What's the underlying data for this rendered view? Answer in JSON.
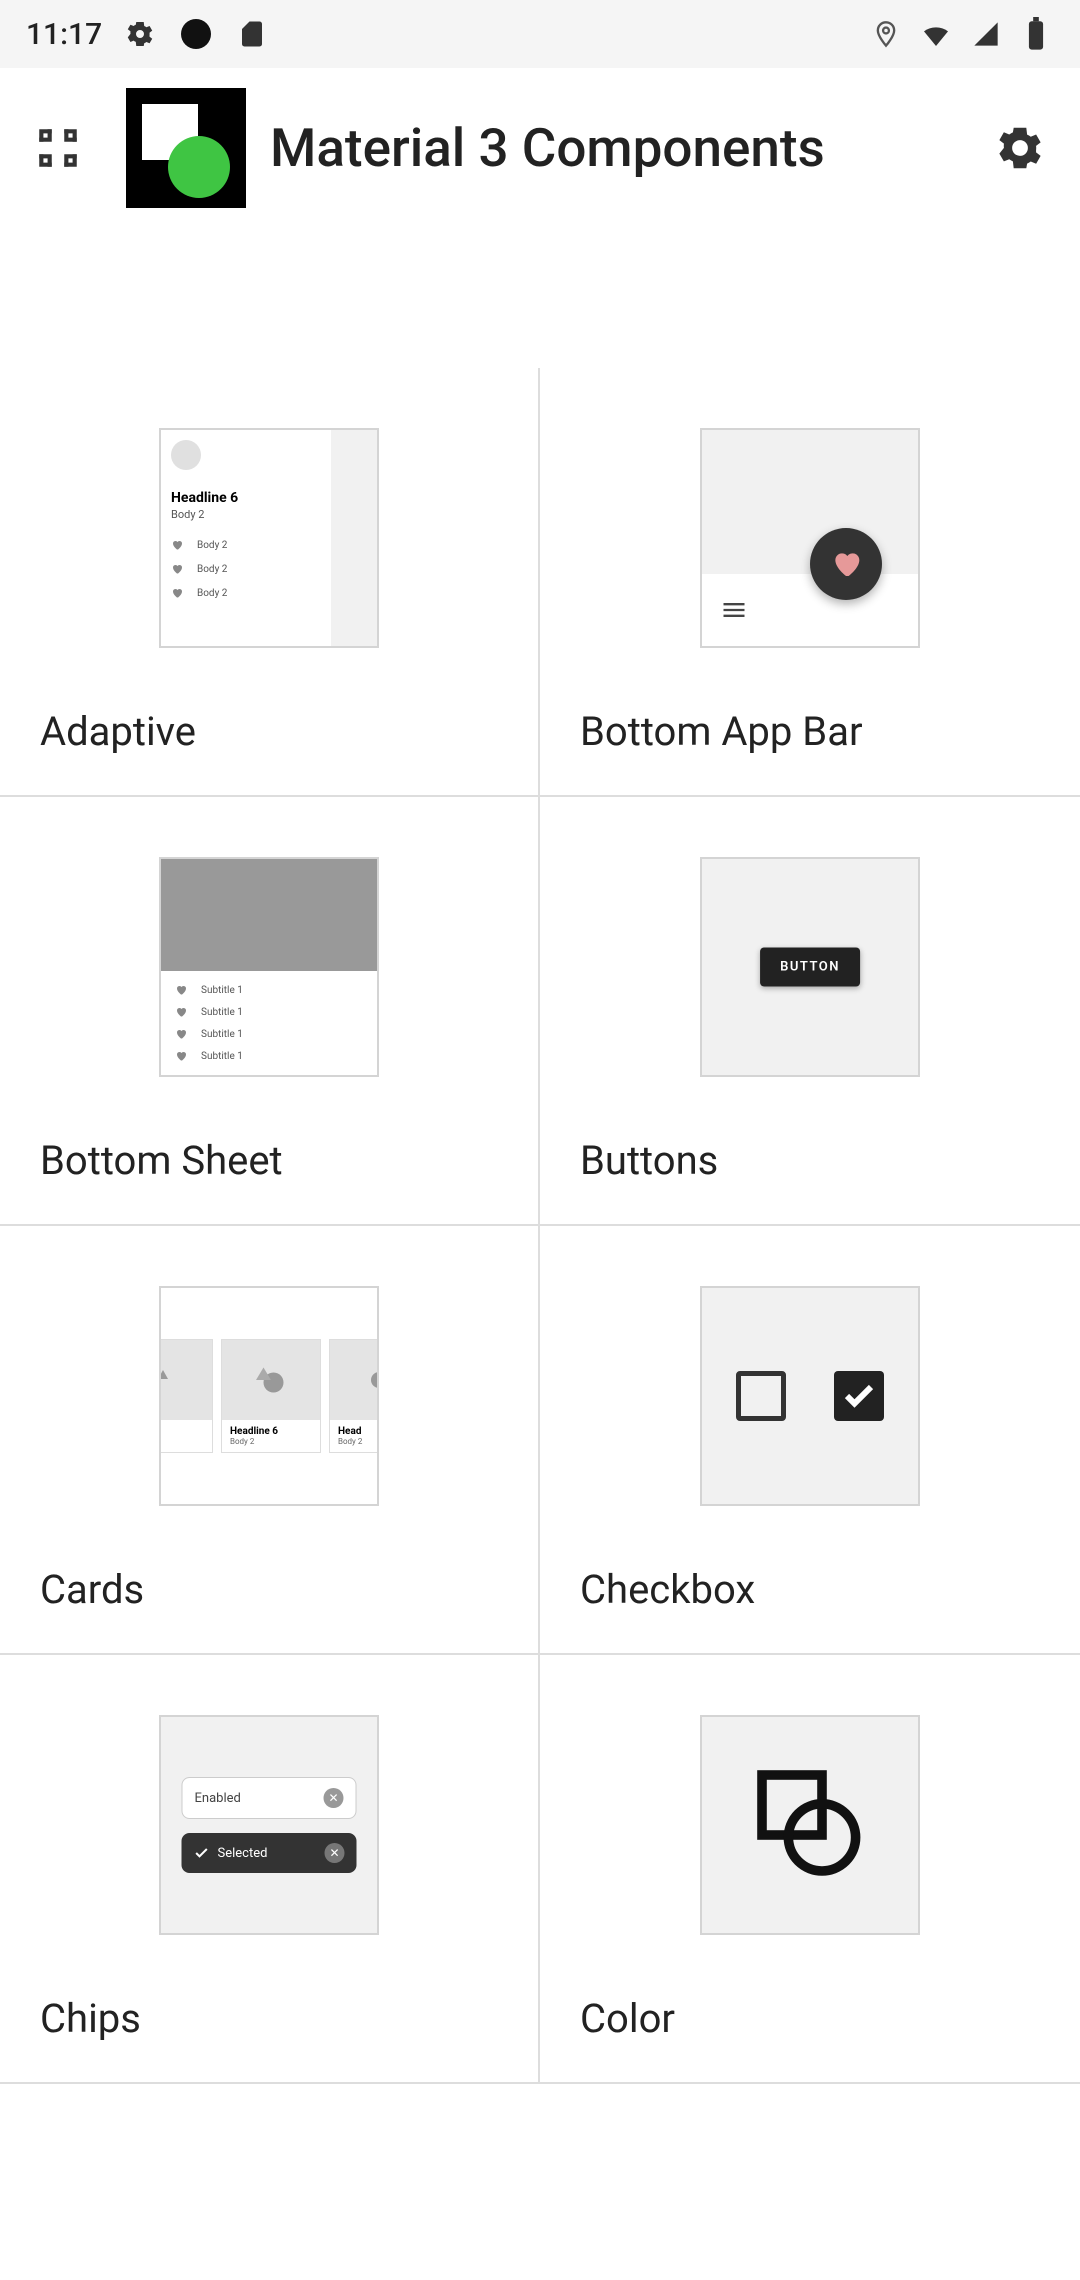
{
  "status_bar": {
    "time": "11:17"
  },
  "header": {
    "title": "Material 3 Components"
  },
  "grid_items": [
    {
      "label": "Adaptive"
    },
    {
      "label": "Bottom App Bar"
    },
    {
      "label": "Bottom Sheet"
    },
    {
      "label": "Buttons"
    },
    {
      "label": "Cards"
    },
    {
      "label": "Checkbox"
    },
    {
      "label": "Chips"
    },
    {
      "label": "Color"
    }
  ],
  "preview_content": {
    "adaptive": {
      "headline": "Headline 6",
      "body": "Body 2",
      "rows": [
        "Body 2",
        "Body 2",
        "Body 2"
      ]
    },
    "bottom_sheet": {
      "rows": [
        "Subtitle 1",
        "Subtitle 1",
        "Subtitle 1",
        "Subtitle 1"
      ]
    },
    "buttons": {
      "label": "BUTTON"
    },
    "cards": {
      "headline": "Headline 6",
      "body": "Body 2"
    },
    "chips": {
      "enabled": "Enabled",
      "selected": "Selected"
    }
  }
}
